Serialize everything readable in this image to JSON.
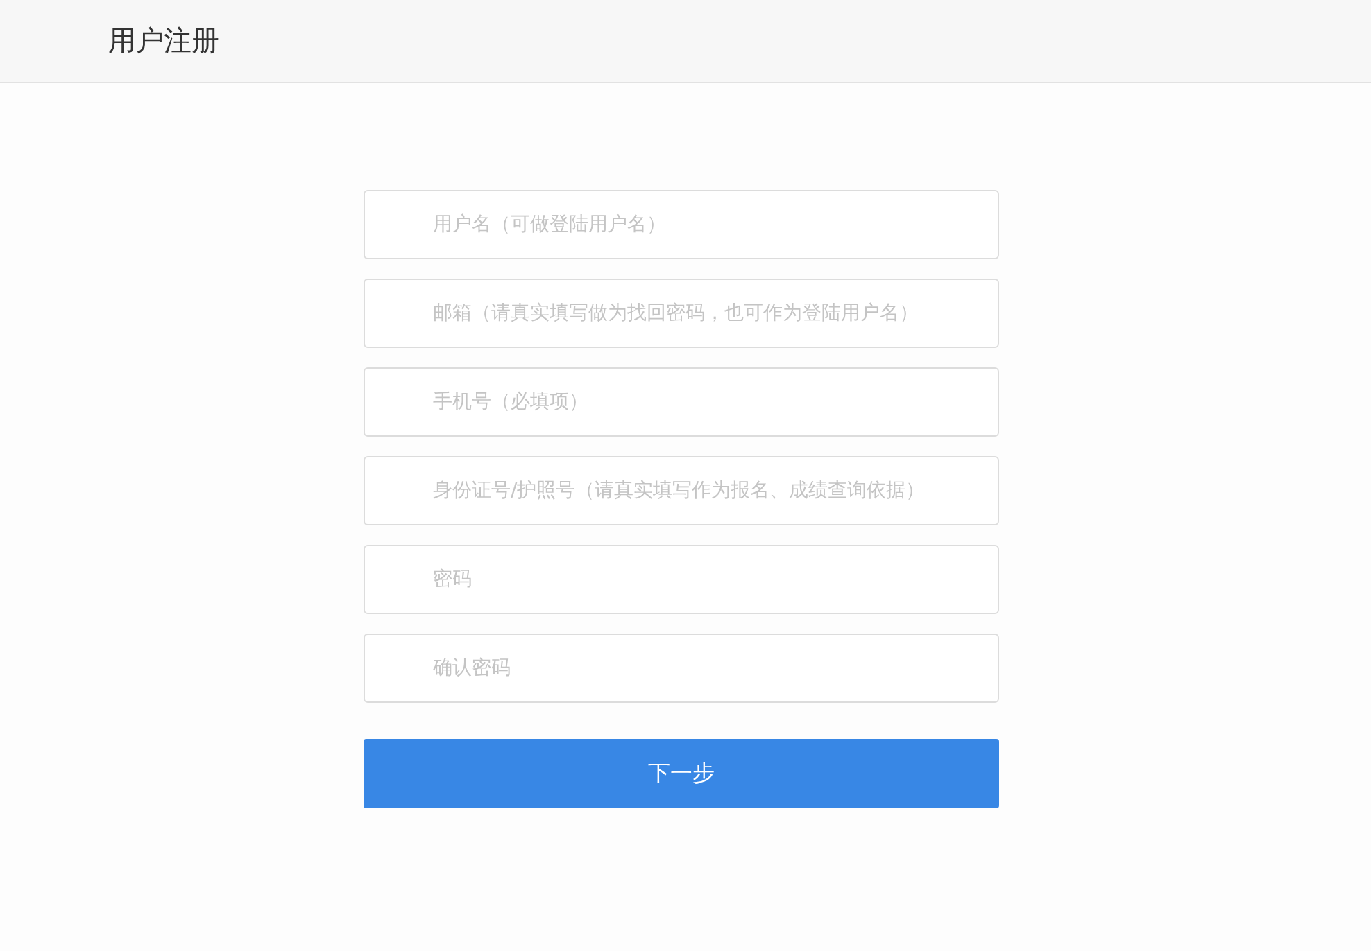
{
  "header": {
    "title": "用户注册"
  },
  "fields": [
    {
      "placeholder": "用户名（可做登陆用户名）"
    },
    {
      "placeholder": "邮箱（请真实填写做为找回密码，也可作为登陆用户名）"
    },
    {
      "placeholder": "手机号（必填项）"
    },
    {
      "placeholder": "身份证号/护照号（请真实填写作为报名、成绩查询依据）"
    },
    {
      "placeholder": "密码"
    },
    {
      "placeholder": "确认密码"
    }
  ],
  "submit": {
    "label": "下一步"
  }
}
